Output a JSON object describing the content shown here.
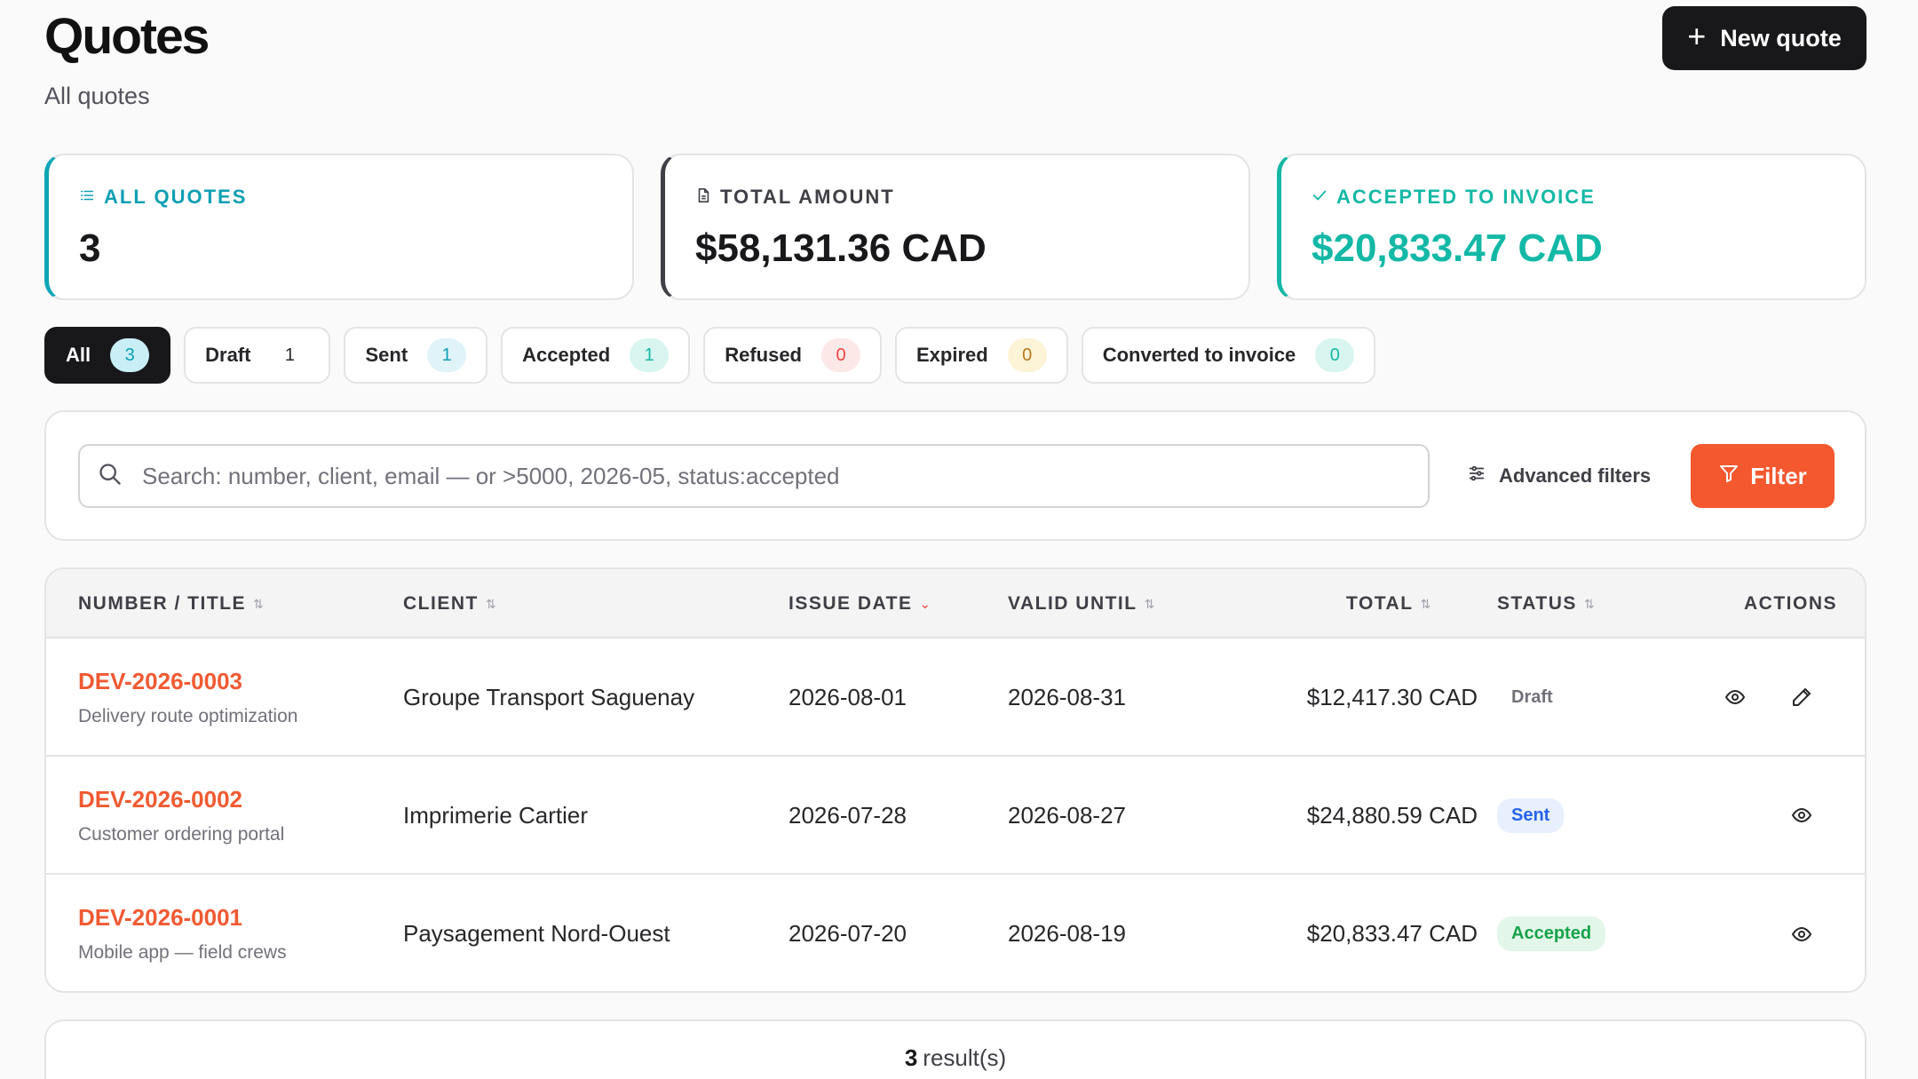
{
  "header": {
    "title": "Quotes",
    "subtitle": "All quotes",
    "new_quote_label": "New quote"
  },
  "stats": [
    {
      "icon": "list-icon",
      "label": "ALL QUOTES",
      "value": "3"
    },
    {
      "icon": "document-icon",
      "label": "TOTAL AMOUNT",
      "value": "$58,131.36 CAD"
    },
    {
      "icon": "check-icon",
      "label": "ACCEPTED TO INVOICE",
      "value": "$20,833.47 CAD"
    }
  ],
  "tabs": [
    {
      "label": "All",
      "count": "3"
    },
    {
      "label": "Draft",
      "count": "1"
    },
    {
      "label": "Sent",
      "count": "1"
    },
    {
      "label": "Accepted",
      "count": "1"
    },
    {
      "label": "Refused",
      "count": "0"
    },
    {
      "label": "Expired",
      "count": "0"
    },
    {
      "label": "Converted to invoice",
      "count": "0"
    }
  ],
  "search": {
    "placeholder": "Search: number, client, email — or >5000, 2026-05, status:accepted",
    "advanced_label": "Advanced filters",
    "filter_label": "Filter"
  },
  "table": {
    "columns": {
      "number": "NUMBER / TITLE",
      "client": "CLIENT",
      "issue_date": "ISSUE DATE",
      "valid_until": "VALID UNTIL",
      "total": "TOTAL",
      "status": "STATUS",
      "actions": "ACTIONS"
    },
    "rows": [
      {
        "number": "DEV-2026-0003",
        "title": "Delivery route optimization",
        "client": "Groupe Transport Saguenay",
        "issue_date": "2026-08-01",
        "valid_until": "2026-08-31",
        "total": "$12,417.30 CAD",
        "status": "Draft"
      },
      {
        "number": "DEV-2026-0002",
        "title": "Customer ordering portal",
        "client": "Imprimerie Cartier",
        "issue_date": "2026-07-28",
        "valid_until": "2026-08-27",
        "total": "$24,880.59 CAD",
        "status": "Sent"
      },
      {
        "number": "DEV-2026-0001",
        "title": "Mobile app — field crews",
        "client": "Paysagement Nord-Ouest",
        "issue_date": "2026-07-20",
        "valid_until": "2026-08-19",
        "total": "$20,833.47 CAD",
        "status": "Accepted"
      }
    ]
  },
  "footer": {
    "count": "3",
    "suffix": "result(s)"
  },
  "colors": {
    "accent": "#f4582f",
    "teal": "#0e9fb3",
    "green": "#14b8a6",
    "dark": "#18181b"
  }
}
